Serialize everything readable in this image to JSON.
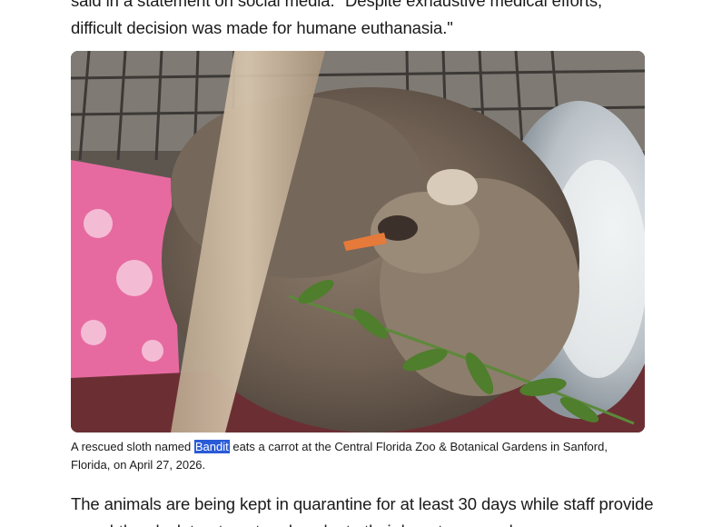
{
  "article": {
    "paragraph_top_lines": [
      "said in a statement on social media. \"Despite exhaustive medical efforts,",
      "difficult decision was made for humane euthanasia.\""
    ],
    "figure": {
      "image_description_icon": "sloth-photo"
    },
    "caption": {
      "before": "A rescued sloth named ",
      "highlight": "Bandit",
      "after_line1": " eats a carrot at the Central Florida Zoo & Botanical Gardens in Sanford,",
      "line2": "Florida, on April 27, 2026."
    },
    "paragraph_bottom_lines": [
      "The animals are being kept in quarantine for at least 30 days while staff provide",
      "round-the-clock treatment and evaluate their long-term needs."
    ]
  }
}
